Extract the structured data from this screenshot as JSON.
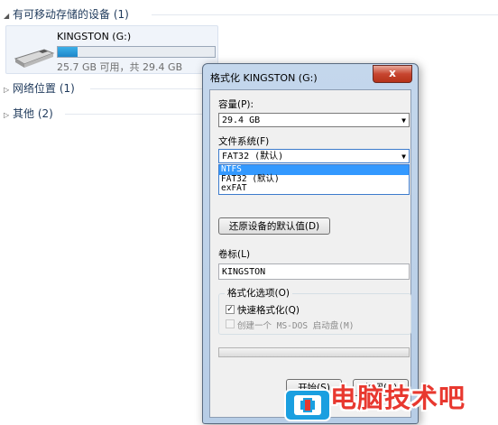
{
  "explorer": {
    "removable_header": "有可移动存储的设备 (1)",
    "network_header": "网络位置 (1)",
    "other_header": "其他 (2)",
    "drive": {
      "name": "KINGSTON (G:)",
      "free_text": "25.7 GB 可用，共 29.4 GB",
      "used_fraction": 0.126
    }
  },
  "dialog": {
    "title": "格式化 KINGSTON (G:)",
    "close_label": "x",
    "capacity_label": "容量(P):",
    "capacity_value": "29.4 GB",
    "filesystem_label": "文件系统(F)",
    "filesystem_value": "FAT32 (默认)",
    "filesystem_options": [
      "NTFS",
      "FAT32 (默认)",
      "exFAT"
    ],
    "restore_button": "还原设备的默认值(D)",
    "volume_label_label": "卷标(L)",
    "volume_label_value": "KINGSTON",
    "options_group_title": "格式化选项(O)",
    "quick_format_label": "快速格式化(Q)",
    "msdos_label": "创建一个 MS-DOS 启动盘(M)",
    "start_button": "开始(S)",
    "close_button": "关闭(C)"
  },
  "watermark": {
    "text": "电脑技术吧"
  }
}
